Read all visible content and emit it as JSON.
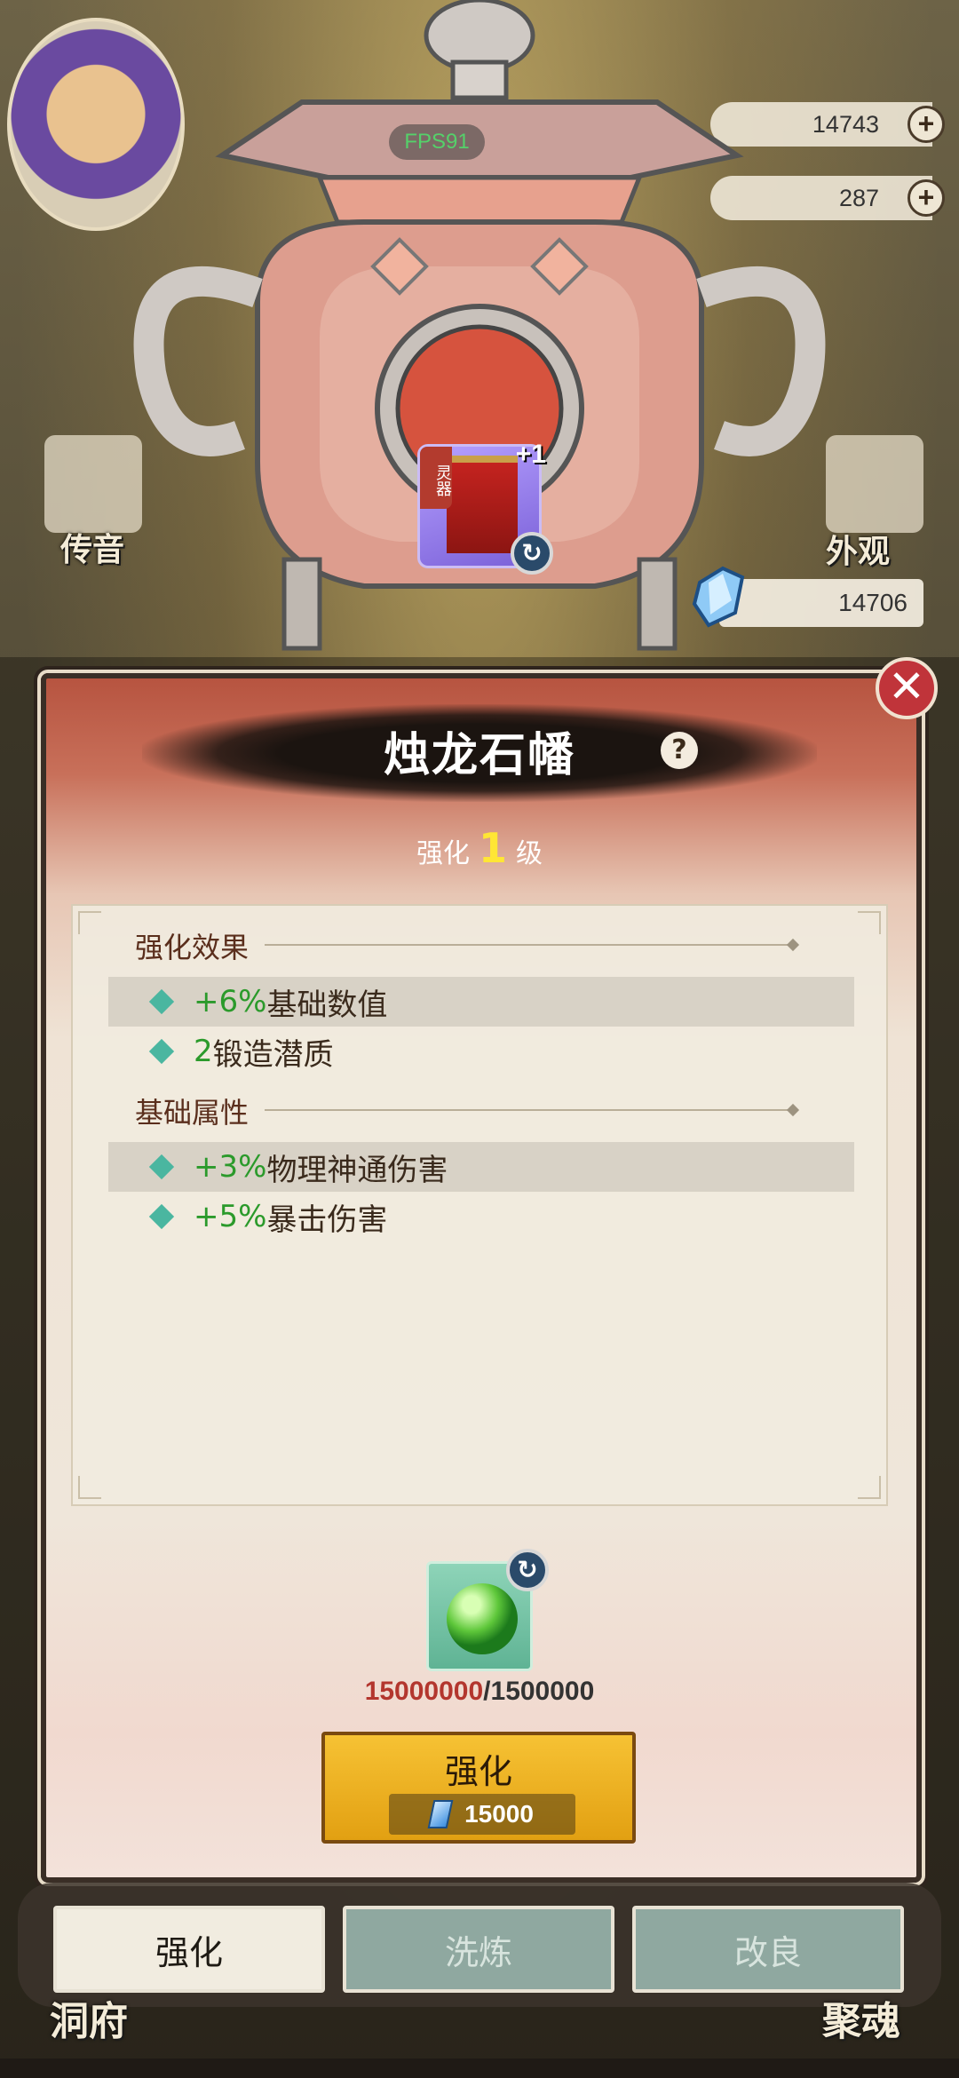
{
  "hud": {
    "fps": "FPS91",
    "resource_top": "14743",
    "resource_second": "287",
    "crystal_amount": "14706",
    "side_left_label": "传音",
    "side_right_label": "外观",
    "bottom_left_label": "洞府",
    "bottom_right_label": "聚魂"
  },
  "item": {
    "tag": "灵器",
    "level_badge": "+1"
  },
  "panel": {
    "title": "烛龙石幡",
    "help": "?",
    "level_prefix": "强化",
    "level_value": "1",
    "level_suffix": "级",
    "close": "✕"
  },
  "sections": {
    "effect_title": "强化效果",
    "effect_rows": [
      {
        "value": "+6%",
        "text": "基础数值"
      },
      {
        "value": "2",
        "text": "锻造潜质"
      }
    ],
    "base_title": "基础属性",
    "base_rows": [
      {
        "value": "+3%",
        "text": "物理神通伤害"
      },
      {
        "value": "+5%",
        "text": "暴击伤害"
      }
    ]
  },
  "material": {
    "have": "15000000",
    "need": "/1500000"
  },
  "upgrade": {
    "label": "强化",
    "cost": "15000"
  },
  "tabs": [
    "强化",
    "洗炼",
    "改良"
  ],
  "colors": {
    "accent_gold": "#f6c234",
    "close_red": "#c0343a",
    "stat_green": "#2b9a2b",
    "level_yellow": "#ffe635"
  }
}
